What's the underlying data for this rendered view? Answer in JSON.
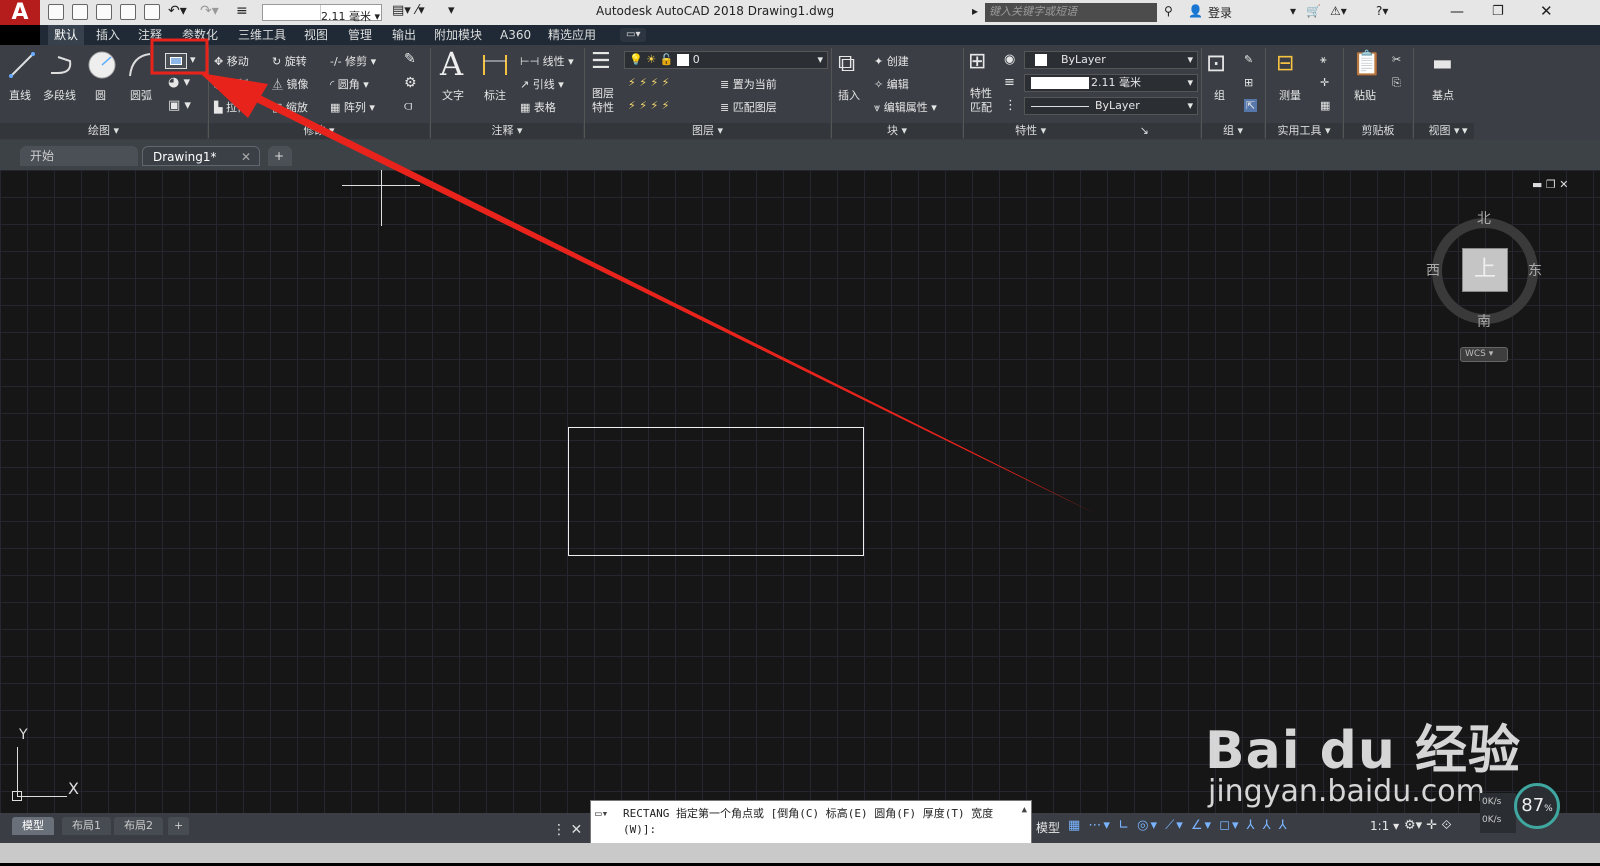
{
  "title_bar": {
    "app_title": "Autodesk AutoCAD 2018    Drawing1.dwg",
    "workspace_value": "2.11 毫米",
    "search_placeholder": "键入关键字或短语",
    "login_label": "登录",
    "app_logo": "A"
  },
  "menu_tabs": [
    "默认",
    "插入",
    "注释",
    "参数化",
    "三维工具",
    "视图",
    "管理",
    "输出",
    "附加模块",
    "A360",
    "精选应用"
  ],
  "ribbon": {
    "draw": {
      "panel": "绘图",
      "line": "直线",
      "polyline": "多段线",
      "circle": "圆",
      "arc": "圆弧"
    },
    "modify": {
      "panel": "修改",
      "move": "移动",
      "rotate": "旋转",
      "trim": "修剪",
      "copy": "复制",
      "mirror": "镜像",
      "fillet": "圆角",
      "stretch": "拉伸",
      "scale": "缩放",
      "array": "阵列"
    },
    "annotation": {
      "panel": "注释",
      "text": "文字",
      "dimension": "标注",
      "linear": "线性",
      "leader": "引线",
      "table": "表格"
    },
    "layers": {
      "panel": "图层",
      "layer_properties": "图层\n特性",
      "current_layer": "0",
      "set_current": "置为当前",
      "match_layer": "匹配图层"
    },
    "block": {
      "panel": "块",
      "insert": "插入",
      "create": "创建",
      "edit": "编辑",
      "edit_attributes": "编辑属性"
    },
    "properties": {
      "panel": "特性",
      "match_properties": "特性\n匹配",
      "color": "ByLayer",
      "lineweight": "2.11 毫米",
      "linetype": "ByLayer"
    },
    "groups": {
      "panel": "组",
      "group": "组"
    },
    "utilities": {
      "panel": "实用工具",
      "measure": "测量"
    },
    "clipboard": {
      "panel": "剪贴板",
      "paste": "粘贴"
    },
    "view": {
      "panel": "视图",
      "base": "基点"
    }
  },
  "doc_tabs": {
    "start": "开始",
    "drawing": "Drawing1*",
    "add": "+"
  },
  "viewcube": {
    "north": "北",
    "south": "南",
    "east": "东",
    "west": "西",
    "top": "上",
    "wcs": "WCS"
  },
  "ucs": {
    "y": "Y",
    "x": "X"
  },
  "command_line": {
    "text": "RECTANG 指定第一个角点或 [倒角(C) 标高(E) 圆角(F) 厚度(T) 宽度(W)]:"
  },
  "layout_tabs": [
    "模型",
    "布局1",
    "布局2"
  ],
  "status": {
    "model": "模型",
    "scale": "1:1",
    "net_percent": "87",
    "net_up": "0K/s",
    "net_down": "0K/s"
  },
  "watermark": {
    "brand": "Bai du 经验",
    "url": "jingyan.baidu.com"
  },
  "colors": {
    "annotation_red": "#e8231c",
    "app_red": "#b51c1c",
    "ribbon": "#3b3f45",
    "canvas": "#161616"
  }
}
